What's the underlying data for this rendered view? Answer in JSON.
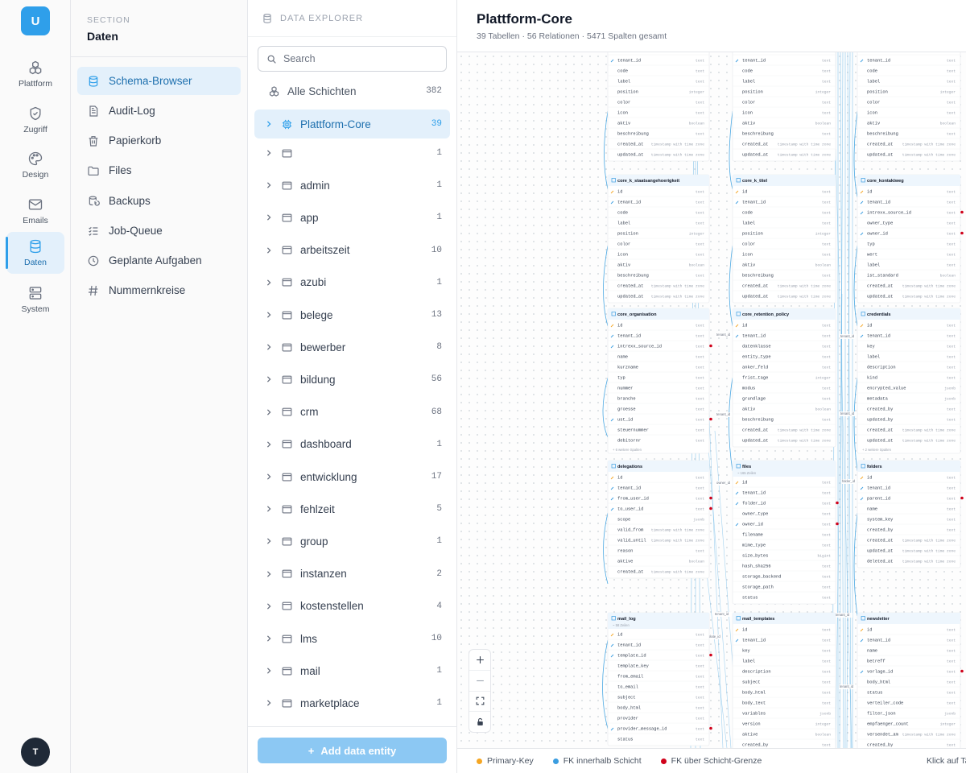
{
  "rail": {
    "brand": "U",
    "items": [
      {
        "label": "Plattform",
        "icon": "cubes-icon"
      },
      {
        "label": "Zugriff",
        "icon": "shield-check-icon"
      },
      {
        "label": "Design",
        "icon": "palette-icon"
      },
      {
        "label": "Emails",
        "icon": "envelope-icon"
      },
      {
        "label": "Daten",
        "icon": "database-icon",
        "active": true
      },
      {
        "label": "System",
        "icon": "server-icon"
      }
    ],
    "user_initial": "T"
  },
  "section": {
    "eyebrow": "SECTION",
    "title": "Daten",
    "items": [
      {
        "label": "Schema-Browser",
        "icon": "database-icon",
        "active": true
      },
      {
        "label": "Audit-Log",
        "icon": "log-icon"
      },
      {
        "label": "Papierkorb",
        "icon": "trash-icon"
      },
      {
        "label": "Files",
        "icon": "folder-icon"
      },
      {
        "label": "Backups",
        "icon": "backup-icon"
      },
      {
        "label": "Job-Queue",
        "icon": "list-check-icon"
      },
      {
        "label": "Geplante Aufgaben",
        "icon": "clock-icon"
      },
      {
        "label": "Nummernkreise",
        "icon": "hash-icon"
      }
    ]
  },
  "explorer": {
    "title": "DATA EXPLORER",
    "search_placeholder": "Search",
    "all": {
      "label": "Alle Schichten",
      "count": "382"
    },
    "rows": [
      {
        "label": "Plattform-Core",
        "count": "39",
        "active": true
      },
      {
        "label": "",
        "count": "1"
      },
      {
        "label": "admin",
        "count": "1"
      },
      {
        "label": "app",
        "count": "1"
      },
      {
        "label": "arbeitszeit",
        "count": "10"
      },
      {
        "label": "azubi",
        "count": "1"
      },
      {
        "label": "belege",
        "count": "13"
      },
      {
        "label": "bewerber",
        "count": "8"
      },
      {
        "label": "bildung",
        "count": "56"
      },
      {
        "label": "crm",
        "count": "68"
      },
      {
        "label": "dashboard",
        "count": "1"
      },
      {
        "label": "entwicklung",
        "count": "17"
      },
      {
        "label": "fehlzeit",
        "count": "5"
      },
      {
        "label": "group",
        "count": "1"
      },
      {
        "label": "instanzen",
        "count": "2"
      },
      {
        "label": "kostenstellen",
        "count": "4"
      },
      {
        "label": "lms",
        "count": "10"
      },
      {
        "label": "mail",
        "count": "1"
      },
      {
        "label": "marketplace",
        "count": "1"
      }
    ],
    "add_button": "Add data entity"
  },
  "main": {
    "title": "Plattform-Core",
    "subtitle": "39 Tabellen · 56 Relationen · 5471 Spalten gesamt"
  },
  "legend": {
    "items": [
      {
        "label": "Primary-Key",
        "color": "#f5a623"
      },
      {
        "label": "FK innerhalb Schicht",
        "color": "#3b9de0"
      },
      {
        "label": "FK über Schicht-Grenze",
        "color": "#d0021b"
      }
    ],
    "hint": "Klick auf Ta"
  },
  "er": {
    "tables": [
      {
        "name": "",
        "rows": [
          [
            "id",
            "text"
          ],
          [
            "tenant_id",
            "text"
          ],
          [
            "code",
            "text"
          ],
          [
            "label",
            "text"
          ],
          [
            "position",
            "integer"
          ],
          [
            "color",
            "text"
          ],
          [
            "icon",
            "text"
          ],
          [
            "aktiv",
            "boolean"
          ],
          [
            "beschreibung",
            "text"
          ],
          [
            "created_at",
            "timestamp with time zone"
          ],
          [
            "updated_at",
            "timestamp with time zone"
          ]
        ]
      },
      {
        "name": "",
        "rows": [
          [
            "id",
            "text"
          ],
          [
            "tenant_id",
            "text"
          ],
          [
            "code",
            "text"
          ],
          [
            "label",
            "text"
          ],
          [
            "position",
            "integer"
          ],
          [
            "color",
            "text"
          ],
          [
            "icon",
            "text"
          ],
          [
            "aktiv",
            "boolean"
          ],
          [
            "beschreibung",
            "text"
          ],
          [
            "created_at",
            "timestamp with time zone"
          ],
          [
            "updated_at",
            "timestamp with time zone"
          ]
        ]
      },
      {
        "name": "",
        "rows": [
          [
            "id",
            "text"
          ],
          [
            "tenant_id",
            "text"
          ],
          [
            "code",
            "text"
          ],
          [
            "label",
            "text"
          ],
          [
            "position",
            "integer"
          ],
          [
            "color",
            "text"
          ],
          [
            "icon",
            "text"
          ],
          [
            "aktiv",
            "boolean"
          ],
          [
            "beschreibung",
            "text"
          ],
          [
            "created_at",
            "timestamp with time zone"
          ],
          [
            "updated_at",
            "timestamp with time zone"
          ]
        ]
      },
      {
        "name": "core_k_staatsangehoerigkeit",
        "rows": [
          [
            "id",
            "text"
          ],
          [
            "tenant_id",
            "text"
          ],
          [
            "code",
            "text"
          ],
          [
            "label",
            "text"
          ],
          [
            "position",
            "integer"
          ],
          [
            "color",
            "text"
          ],
          [
            "icon",
            "text"
          ],
          [
            "aktiv",
            "boolean"
          ],
          [
            "beschreibung",
            "text"
          ],
          [
            "created_at",
            "timestamp with time zone"
          ],
          [
            "updated_at",
            "timestamp with time zone"
          ]
        ]
      },
      {
        "name": "core_k_titel",
        "rows": [
          [
            "id",
            "text"
          ],
          [
            "tenant_id",
            "text"
          ],
          [
            "code",
            "text"
          ],
          [
            "label",
            "text"
          ],
          [
            "position",
            "integer"
          ],
          [
            "color",
            "text"
          ],
          [
            "icon",
            "text"
          ],
          [
            "aktiv",
            "boolean"
          ],
          [
            "beschreibung",
            "text"
          ],
          [
            "created_at",
            "timestamp with time zone"
          ],
          [
            "updated_at",
            "timestamp with time zone"
          ]
        ]
      },
      {
        "name": "core_kontaktweg",
        "rows": [
          [
            "id",
            "text"
          ],
          [
            "tenant_id",
            "text"
          ],
          [
            "intrexx_source_id",
            "text"
          ],
          [
            "owner_type",
            "text"
          ],
          [
            "owner_id",
            "text"
          ],
          [
            "typ",
            "text"
          ],
          [
            "wert",
            "text"
          ],
          [
            "label",
            "text"
          ],
          [
            "ist_standard",
            "boolean"
          ],
          [
            "created_at",
            "timestamp with time zone"
          ],
          [
            "updated_at",
            "timestamp with time zone"
          ]
        ]
      },
      {
        "name": "core_organisation",
        "rows": [
          [
            "id",
            "text"
          ],
          [
            "tenant_id",
            "text"
          ],
          [
            "intrexx_source_id",
            "text"
          ],
          [
            "name",
            "text"
          ],
          [
            "kurzname",
            "text"
          ],
          [
            "typ",
            "text"
          ],
          [
            "nummer",
            "text"
          ],
          [
            "branche",
            "text"
          ],
          [
            "groesse",
            "text"
          ],
          [
            "ust_id",
            "text"
          ],
          [
            "steuernummer",
            "text"
          ],
          [
            "debitornr",
            "text"
          ]
        ],
        "more": "+ 6 weitere Spalten"
      },
      {
        "name": "core_retention_policy",
        "rows": [
          [
            "id",
            "text"
          ],
          [
            "tenant_id",
            "text"
          ],
          [
            "datenklasse",
            "text"
          ],
          [
            "entity_type",
            "text"
          ],
          [
            "anker_feld",
            "text"
          ],
          [
            "frist_tage",
            "integer"
          ],
          [
            "modus",
            "text"
          ],
          [
            "grundlage",
            "text"
          ],
          [
            "aktiv",
            "boolean"
          ],
          [
            "beschreibung",
            "text"
          ],
          [
            "created_at",
            "timestamp with time zone"
          ],
          [
            "updated_at",
            "timestamp with time zone"
          ]
        ]
      },
      {
        "name": "credentials",
        "rows": [
          [
            "id",
            "text"
          ],
          [
            "tenant_id",
            "text"
          ],
          [
            "key",
            "text"
          ],
          [
            "label",
            "text"
          ],
          [
            "description",
            "text"
          ],
          [
            "kind",
            "text"
          ],
          [
            "encrypted_value",
            "jsonb"
          ],
          [
            "metadata",
            "jsonb"
          ],
          [
            "created_by",
            "text"
          ],
          [
            "updated_by",
            "text"
          ],
          [
            "created_at",
            "timestamp with time zone"
          ],
          [
            "updated_at",
            "timestamp with time zone"
          ]
        ],
        "more": "+ 2 weitere Spalten"
      },
      {
        "name": "delegations",
        "rows": [
          [
            "id",
            "text"
          ],
          [
            "tenant_id",
            "text"
          ],
          [
            "from_user_id",
            "text"
          ],
          [
            "to_user_id",
            "text"
          ],
          [
            "scope",
            "jsonb"
          ],
          [
            "valid_from",
            "timestamp with time zone"
          ],
          [
            "valid_until",
            "timestamp with time zone"
          ],
          [
            "reason",
            "text"
          ],
          [
            "aktive",
            "boolean"
          ],
          [
            "created_at",
            "timestamp with time zone"
          ]
        ]
      },
      {
        "name": "files",
        "sub": "~ 165 Zeilen",
        "rows": [
          [
            "id",
            "text"
          ],
          [
            "tenant_id",
            "text"
          ],
          [
            "folder_id",
            "text"
          ],
          [
            "owner_type",
            "text"
          ],
          [
            "owner_id",
            "text"
          ],
          [
            "filename",
            "text"
          ],
          [
            "mime_type",
            "text"
          ],
          [
            "size_bytes",
            "bigint"
          ],
          [
            "hash_sha256",
            "text"
          ],
          [
            "storage_backend",
            "text"
          ],
          [
            "storage_path",
            "text"
          ],
          [
            "status",
            "text"
          ]
        ]
      },
      {
        "name": "folders",
        "rows": [
          [
            "id",
            "text"
          ],
          [
            "tenant_id",
            "text"
          ],
          [
            "parent_id",
            "text"
          ],
          [
            "name",
            "text"
          ],
          [
            "system_key",
            "text"
          ],
          [
            "created_by",
            "text"
          ],
          [
            "created_at",
            "timestamp with time zone"
          ],
          [
            "updated_at",
            "timestamp with time zone"
          ],
          [
            "deleted_at",
            "timestamp with time zone"
          ]
        ]
      },
      {
        "name": "mail_log",
        "sub": "~ 58 Zeilen",
        "rows": [
          [
            "id",
            "text"
          ],
          [
            "tenant_id",
            "text"
          ],
          [
            "template_id",
            "text"
          ],
          [
            "template_key",
            "text"
          ],
          [
            "from_email",
            "text"
          ],
          [
            "to_email",
            "text"
          ],
          [
            "subject",
            "text"
          ],
          [
            "body_html",
            "text"
          ],
          [
            "provider",
            "text"
          ],
          [
            "provider_message_id",
            "text"
          ],
          [
            "status",
            "text"
          ]
        ]
      },
      {
        "name": "mail_templates",
        "rows": [
          [
            "id",
            "text"
          ],
          [
            "tenant_id",
            "text"
          ],
          [
            "key",
            "text"
          ],
          [
            "label",
            "text"
          ],
          [
            "description",
            "text"
          ],
          [
            "subject",
            "text"
          ],
          [
            "body_html",
            "text"
          ],
          [
            "body_text",
            "text"
          ],
          [
            "variables",
            "jsonb"
          ],
          [
            "version",
            "integer"
          ],
          [
            "aktive",
            "boolean"
          ],
          [
            "created_by",
            "text"
          ]
        ]
      },
      {
        "name": "newsletter",
        "rows": [
          [
            "id",
            "text"
          ],
          [
            "tenant_id",
            "text"
          ],
          [
            "name",
            "text"
          ],
          [
            "betreff",
            "text"
          ],
          [
            "vorlage_id",
            "text"
          ],
          [
            "body_html",
            "text"
          ],
          [
            "status",
            "text"
          ],
          [
            "verteiler_code",
            "text"
          ],
          [
            "filter_json",
            "jsonb"
          ],
          [
            "empfaenger_count",
            "integer"
          ],
          [
            "versendet_am",
            "timestamp with time zone"
          ],
          [
            "created_by",
            "text"
          ]
        ]
      }
    ],
    "edge_labels": [
      "tenant_id",
      "tenant_id",
      "tenant_id",
      "tenant_id",
      "owner_id",
      "folder_id",
      "template_id",
      "tenant_id",
      "tenant_id",
      "tenant_id"
    ]
  }
}
